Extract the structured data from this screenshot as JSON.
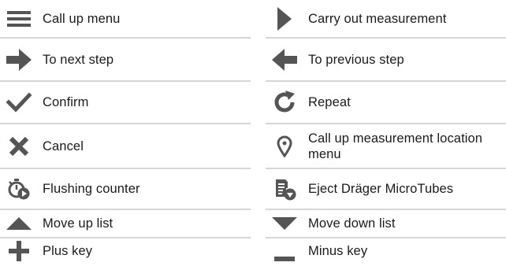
{
  "left": [
    {
      "icon": "menu-icon",
      "label": "Call up menu"
    },
    {
      "icon": "arrow-right-icon",
      "label": "To next step"
    },
    {
      "icon": "checkmark-icon",
      "label": "Confirm"
    },
    {
      "icon": "cross-icon",
      "label": "Cancel"
    },
    {
      "icon": "flushing-counter-icon",
      "label": "Flushing counter"
    },
    {
      "icon": "triangle-up-icon",
      "label": "Move up list"
    },
    {
      "icon": "plus-icon",
      "label": "Plus key"
    }
  ],
  "right": [
    {
      "icon": "play-icon",
      "label": "Carry out measurement"
    },
    {
      "icon": "arrow-left-icon",
      "label": "To previous step"
    },
    {
      "icon": "repeat-icon",
      "label": "Repeat"
    },
    {
      "icon": "location-pin-icon",
      "label": "Call up measurement location menu"
    },
    {
      "icon": "eject-microtubes-icon",
      "label": "Eject Dräger MicroTubes"
    },
    {
      "icon": "triangle-down-icon",
      "label": "Move down list"
    },
    {
      "icon": "minus-icon",
      "label": "Minus key"
    }
  ],
  "colors": {
    "icon": "#555555",
    "divider": "#d6d6d6",
    "text": "#1a1a1a"
  }
}
